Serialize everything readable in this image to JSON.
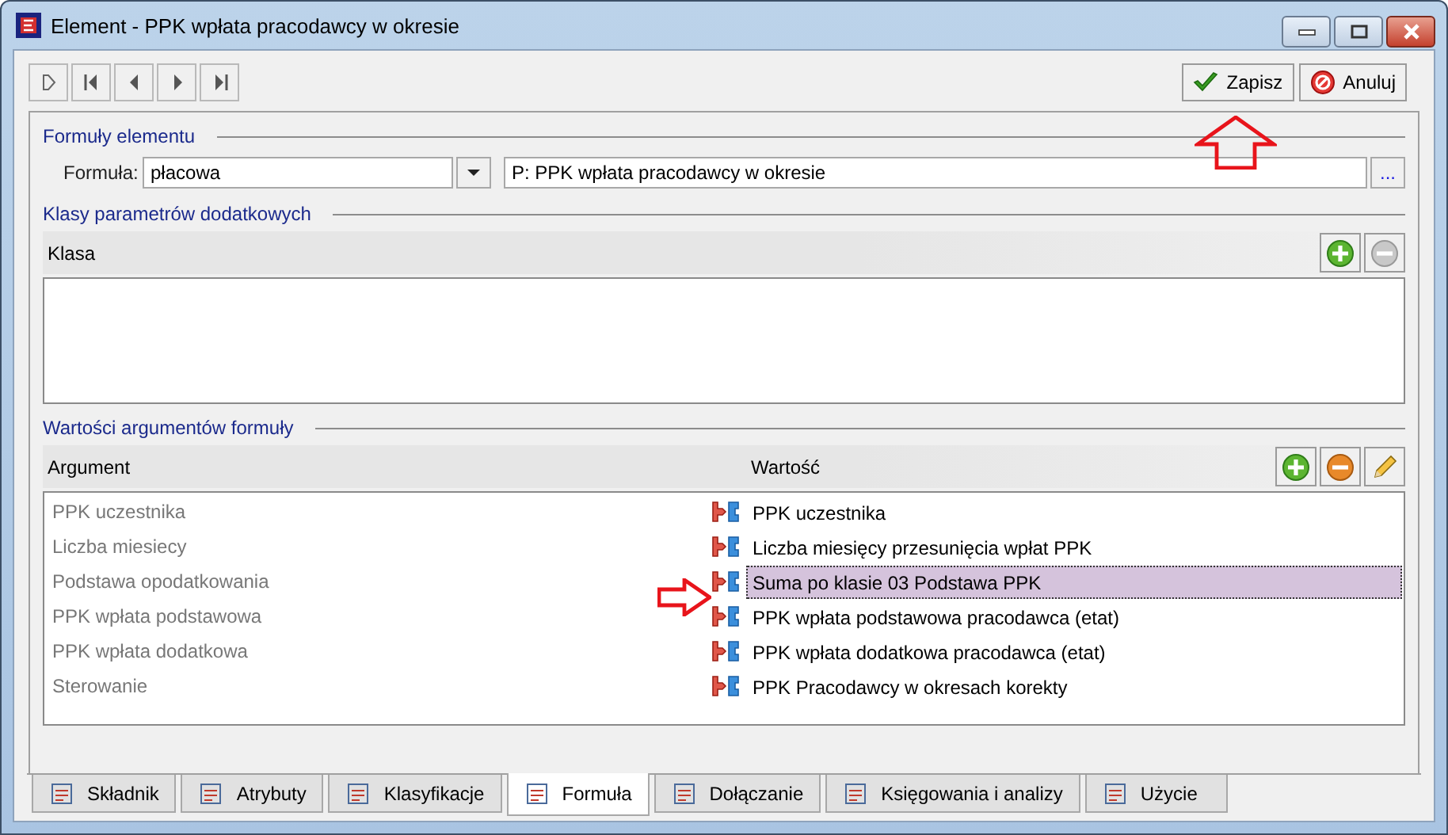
{
  "window": {
    "title": "Element - PPK wpłata pracodawcy w okresie"
  },
  "actions": [
    {
      "label": "Zapisz",
      "kind": "save"
    },
    {
      "label": "Anuluj",
      "kind": "cancel"
    }
  ],
  "formulas": {
    "title": "Formuły elementu",
    "label": "Formuła:",
    "value": "płacowa",
    "description": "P: PPK wpłata pracodawcy w okresie",
    "browse": "..."
  },
  "classes": {
    "title": "Klasy parametrów dodatkowych",
    "columns": [
      "Klasa"
    ]
  },
  "arguments": {
    "title": "Wartości argumentów formuły",
    "columns": [
      "Argument",
      "Wartość"
    ],
    "rows": [
      {
        "argument": "PPK uczestnika",
        "value": "PPK uczestnika",
        "selected": false
      },
      {
        "argument": "Liczba miesiecy",
        "value": "Liczba miesięcy przesunięcia wpłat PPK",
        "selected": false
      },
      {
        "argument": "Podstawa opodatkowania",
        "value": "Suma po klasie 03 Podstawa PPK",
        "selected": true
      },
      {
        "argument": "PPK wpłata podstawowa",
        "value": "PPK wpłata podstawowa pracodawca (etat)",
        "selected": false
      },
      {
        "argument": "PPK wpłata dodatkowa",
        "value": "PPK wpłata dodatkowa pracodawca (etat)",
        "selected": false
      },
      {
        "argument": "Sterowanie",
        "value": "PPK Pracodawcy w okresach korekty",
        "selected": false
      }
    ]
  },
  "tabs": [
    {
      "label": "Składnik",
      "selected": false
    },
    {
      "label": "Atrybuty",
      "selected": false
    },
    {
      "label": "Klasyfikacje",
      "selected": false
    },
    {
      "label": "Formuła",
      "selected": true
    },
    {
      "label": "Dołączanie",
      "selected": false
    },
    {
      "label": "Księgowania i analizy",
      "selected": false
    },
    {
      "label": "Użycie",
      "selected": false
    }
  ],
  "annotations": [
    {
      "kind": "up"
    },
    {
      "kind": "right"
    }
  ]
}
